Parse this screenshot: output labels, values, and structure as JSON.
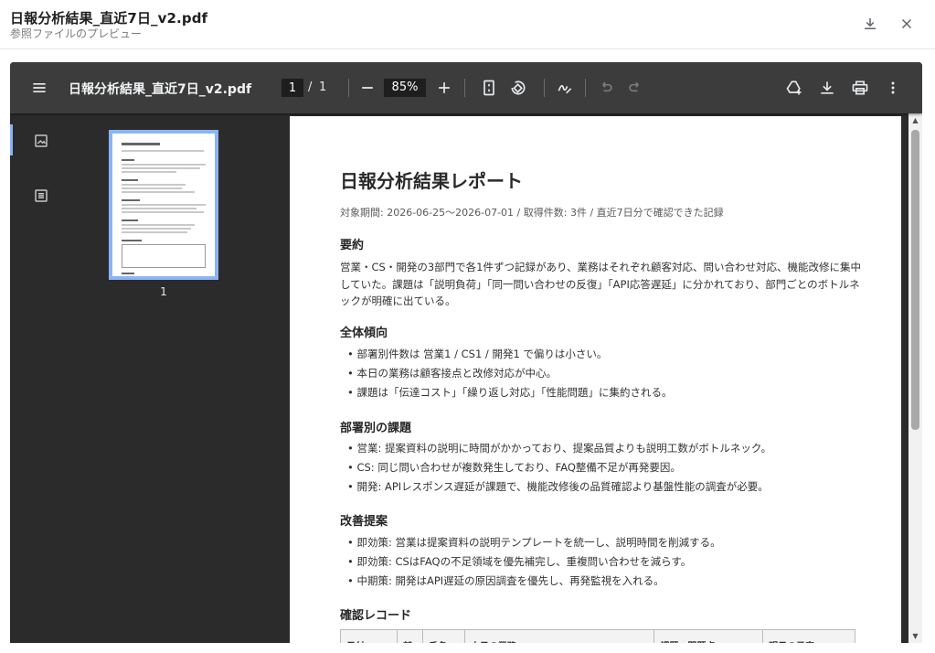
{
  "modal": {
    "title": "日報分析結果_直近7日_v2.pdf",
    "subtitle": "参照ファイルのプレビュー"
  },
  "toolbar": {
    "doc_title": "日報分析結果_直近7日_v2.pdf",
    "page_current": "1",
    "page_separator": "/",
    "page_total": "1",
    "zoom": "85%"
  },
  "sidebar": {
    "thumbnail_page_number": "1"
  },
  "document": {
    "title": "日報分析結果レポート",
    "period": "対象期間: 2026-06-25〜2026-07-01 / 取得件数: 3件 / 直近7日分で確認できた記録",
    "summary_heading": "要約",
    "summary_text": "営業・CS・開発の3部門で各1件ずつ記録があり、業務はそれぞれ顧客対応、問い合わせ対応、機能改修に集中していた。課題は「説明負荷」「同一問い合わせの反復」「API応答遅延」に分かれており、部門ごとのボトルネックが明確に出ている。",
    "trend_heading": "全体傾向",
    "trend_items": [
      "部署別件数は 営業1 / CS1 / 開発1 で偏りは小さい。",
      "本日の業務は顧客接点と改修対応が中心。",
      "課題は「伝達コスト」「繰り返し対応」「性能問題」に集約される。"
    ],
    "dept_heading": "部署別の課題",
    "dept_items": [
      "営業: 提案資料の説明に時間がかかっており、提案品質よりも説明工数がボトルネック。",
      "CS: 同じ問い合わせが複数発生しており、FAQ整備不足が再発要因。",
      "開発: APIレスポンス遅延が課題で、機能改修後の品質確認より基盤性能の調査が必要。"
    ],
    "improve_heading": "改善提案",
    "improve_items": [
      "即効策: 営業は提案資料の説明テンプレートを統一し、説明時間を削減する。",
      "即効策: CSはFAQの不足領域を優先補完し、重複問い合わせを減らす。",
      "中期策: 開発はAPI遅延の原因調査を優先し、再発監視を入れる。"
    ],
    "records_heading": "確認レコード",
    "table_headers": [
      "日付",
      "部",
      "氏名",
      "本日の業務",
      "課題・問題点",
      "明日の予定"
    ]
  }
}
